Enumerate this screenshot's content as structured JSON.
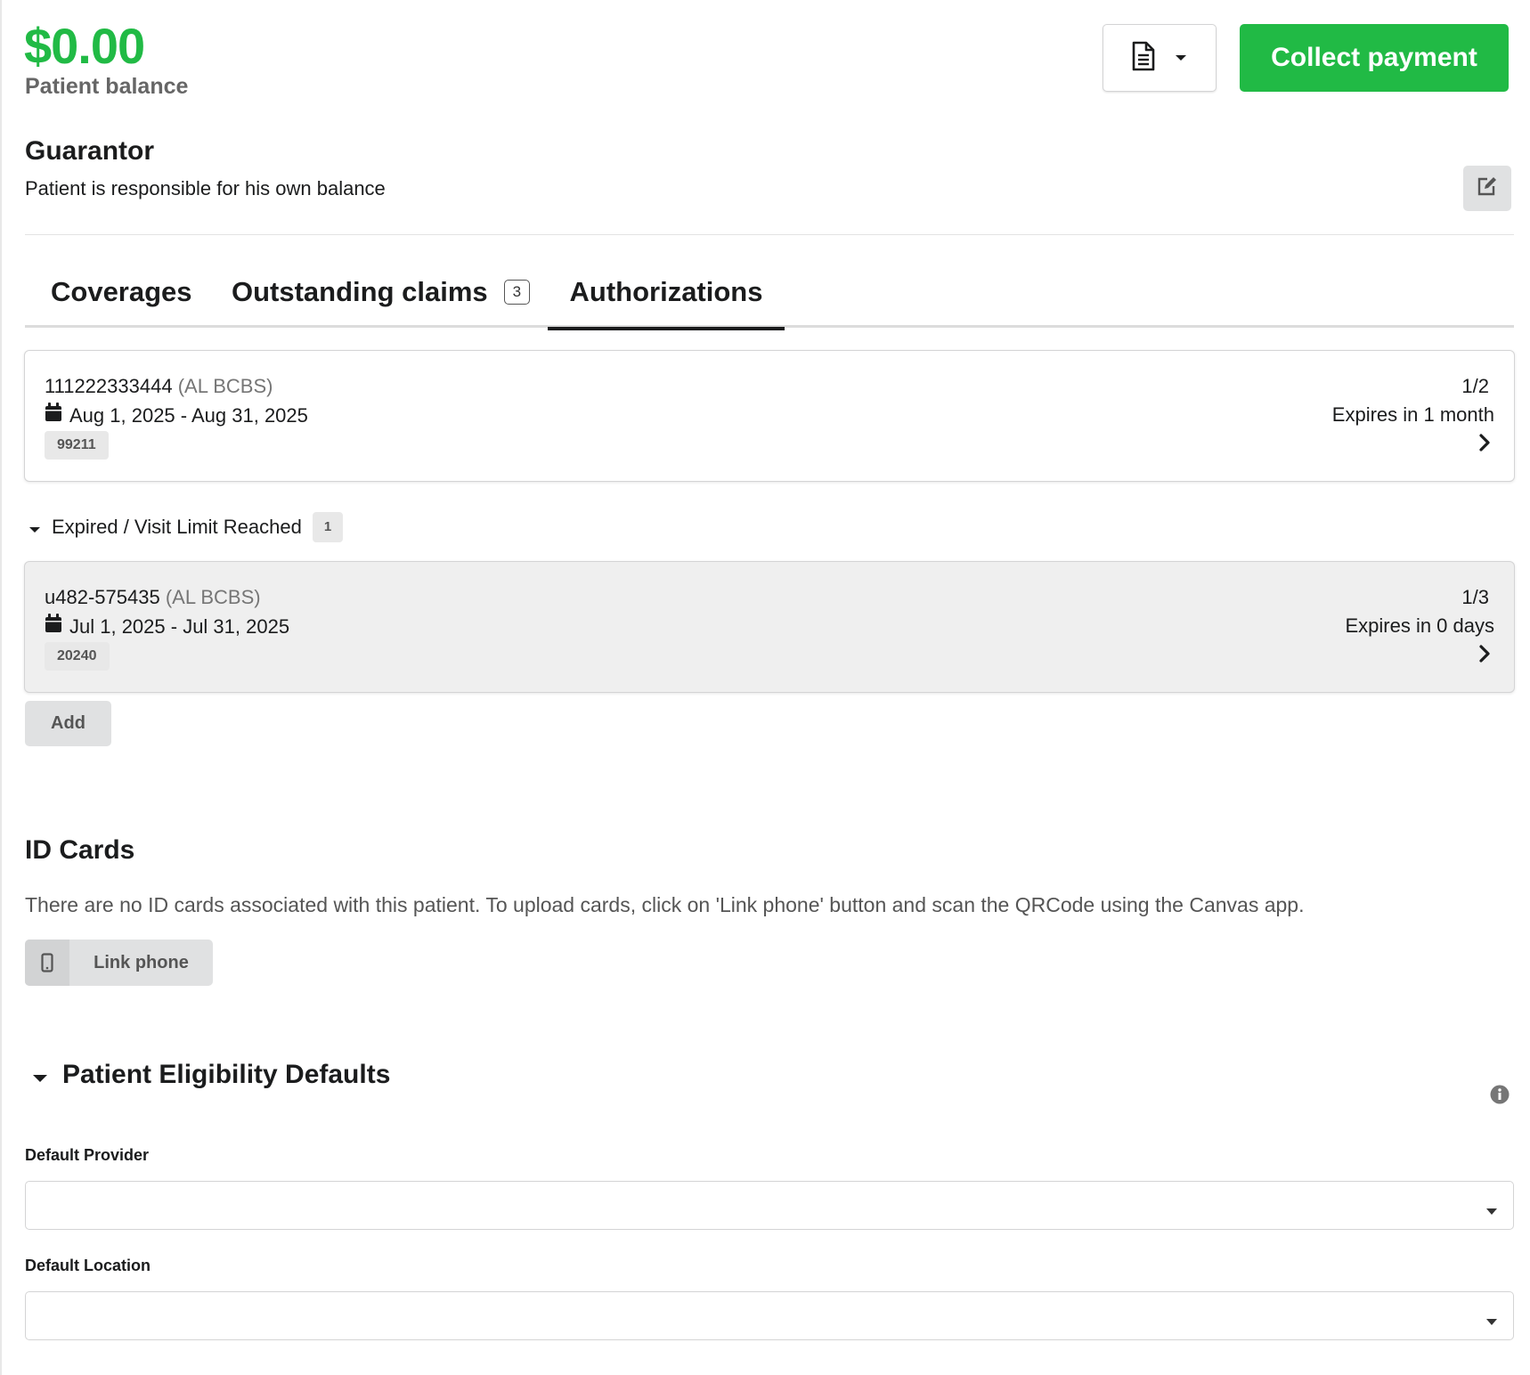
{
  "balance": {
    "amount": "$0.00",
    "label": "Patient balance"
  },
  "header": {
    "collect_payment_label": "Collect payment"
  },
  "guarantor": {
    "title": "Guarantor",
    "description": "Patient is responsible for his own balance"
  },
  "tabs": [
    {
      "label": "Coverages"
    },
    {
      "label": "Outstanding claims",
      "count": "3"
    },
    {
      "label": "Authorizations",
      "active": true
    }
  ],
  "authorizations": {
    "active": [
      {
        "id": "111222333444",
        "payer": "(AL BCBS)",
        "dates": "Aug 1, 2025 - Aug 31, 2025",
        "code": "99211",
        "visits": "1/2",
        "expires": "Expires in 1 month"
      }
    ],
    "expired_section": {
      "label": "Expired / Visit Limit Reached",
      "count": "1"
    },
    "expired": [
      {
        "id": "u482-575435",
        "payer": "(AL BCBS)",
        "dates": "Jul 1, 2025 - Jul 31, 2025",
        "code": "20240",
        "visits": "1/3",
        "expires": "Expires in 0 days"
      }
    ],
    "add_label": "Add"
  },
  "id_cards": {
    "title": "ID Cards",
    "message": "There are no ID cards associated with this patient. To upload cards, click on 'Link phone' button and scan the QRCode using the Canvas app.",
    "link_phone_label": "Link phone"
  },
  "eligibility": {
    "title": "Patient Eligibility Defaults",
    "default_provider_label": "Default Provider",
    "default_provider_value": "",
    "default_location_label": "Default Location",
    "default_location_value": ""
  },
  "colors": {
    "success_green": "#21ba45",
    "muted_gray": "#767676",
    "button_gray": "#e0e1e2"
  },
  "icons": [
    "file-text-icon",
    "caret-down-icon",
    "edit-icon",
    "calendar-icon",
    "chevron-right-icon",
    "mobile-phone-icon",
    "info-icon"
  ]
}
